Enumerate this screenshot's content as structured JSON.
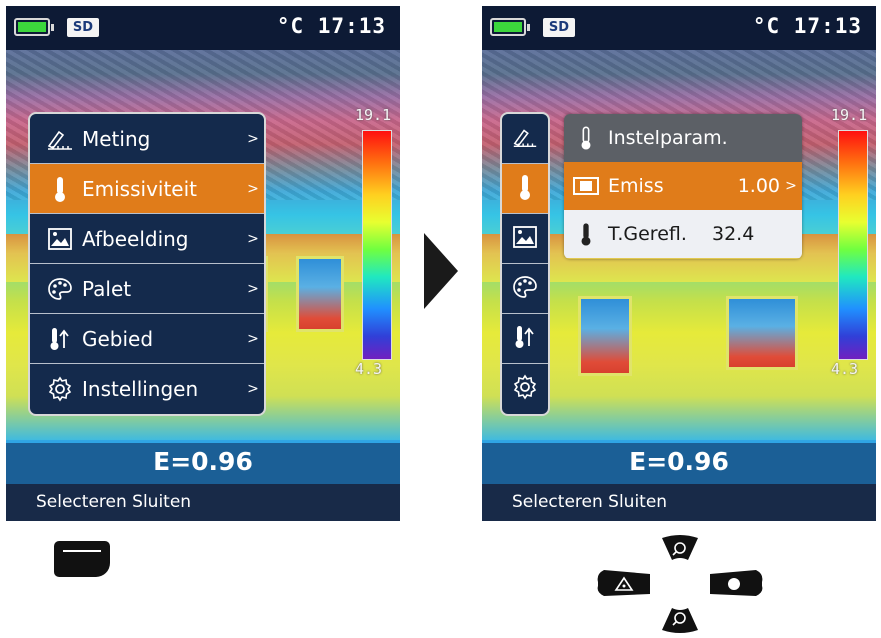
{
  "status": {
    "unit": "°C",
    "time": "17:13",
    "storage": "SD"
  },
  "scale": {
    "max": "19.1",
    "min": "4.3"
  },
  "emissivity_display": "E=0.96",
  "footer": {
    "select": "Selecteren",
    "close": "Sluiten"
  },
  "main_menu": {
    "items": [
      {
        "label": "Meting",
        "icon": "measurement-icon"
      },
      {
        "label": "Emissiviteit",
        "icon": "thermometer-icon",
        "active": true
      },
      {
        "label": "Afbeelding",
        "icon": "image-icon"
      },
      {
        "label": "Palet",
        "icon": "palette-icon"
      },
      {
        "label": "Gebied",
        "icon": "range-icon"
      },
      {
        "label": "Instellingen",
        "icon": "gear-icon"
      }
    ],
    "chevron": ">"
  },
  "sub_menu": {
    "header": "Instelparam.",
    "emiss_label": "Emiss",
    "emiss_value": "1.00",
    "refl_label": "T.Gerefl.",
    "refl_value": "32.4",
    "chevron": ">"
  },
  "colors": {
    "active": "#e07c1a",
    "menu_bg": "#142a4c",
    "header_gray": "#5c6066"
  }
}
